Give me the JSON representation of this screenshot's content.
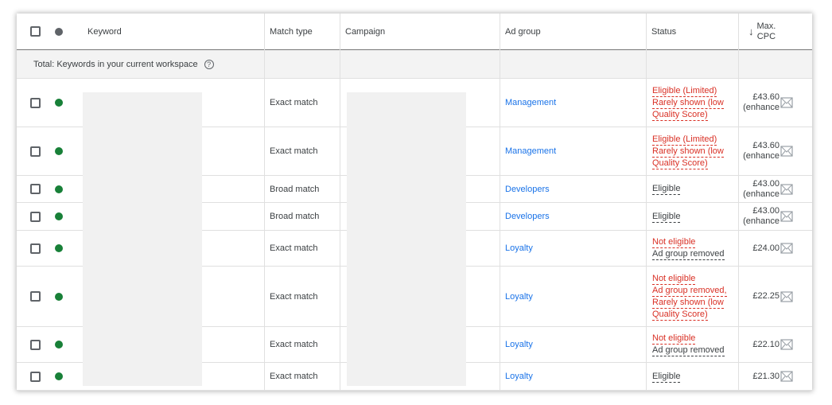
{
  "header": {
    "keyword": "Keyword",
    "match_type": "Match type",
    "campaign": "Campaign",
    "ad_group": "Ad group",
    "status": "Status",
    "max_cpc_line1": "Max.",
    "max_cpc_line2": "CPC"
  },
  "totals": {
    "label": "Total: Keywords in your current workspace"
  },
  "rows": [
    {
      "match_type": "Exact match",
      "ad_group": "Management",
      "status": [
        "Eligible (Limited)",
        "Rarely shown (low",
        "Quality Score)"
      ],
      "status_color": "red",
      "cpc": "£43.60",
      "cpc_note": "(enhance"
    },
    {
      "match_type": "Exact match",
      "ad_group": "Management",
      "status": [
        "Eligible (Limited)",
        "Rarely shown (low",
        "Quality Score)"
      ],
      "status_color": "red",
      "cpc": "£43.60",
      "cpc_note": "(enhance"
    },
    {
      "match_type": "Broad match",
      "ad_group": "Developers",
      "status": [
        "Eligible"
      ],
      "status_color": "dark",
      "cpc": "£43.00",
      "cpc_note": "(enhance"
    },
    {
      "match_type": "Broad match",
      "ad_group": "Developers",
      "status": [
        "Eligible"
      ],
      "status_color": "dark",
      "cpc": "£43.00",
      "cpc_note": "(enhance"
    },
    {
      "match_type": "Exact match",
      "ad_group": "Loyalty",
      "status": [
        "Not eligible",
        "Ad group removed"
      ],
      "status_color": "mixed",
      "cpc": "£24.00",
      "cpc_note": ""
    },
    {
      "match_type": "Exact match",
      "ad_group": "Loyalty",
      "status": [
        "Not eligible",
        "Ad group removed,",
        "Rarely shown (low",
        "Quality Score)"
      ],
      "status_color": "red",
      "cpc": "£22.25",
      "cpc_note": ""
    },
    {
      "match_type": "Exact match",
      "ad_group": "Loyalty",
      "status": [
        "Not eligible",
        "Ad group removed"
      ],
      "status_color": "mixed",
      "cpc": "£22.10",
      "cpc_note": ""
    },
    {
      "match_type": "Exact match",
      "ad_group": "Loyalty",
      "status": [
        "Eligible"
      ],
      "status_color": "dark",
      "cpc": "£21.30",
      "cpc_note": ""
    }
  ],
  "colors": {
    "link": "#1a73e8",
    "status_red": "#d93025",
    "enabled_green": "#188038"
  }
}
